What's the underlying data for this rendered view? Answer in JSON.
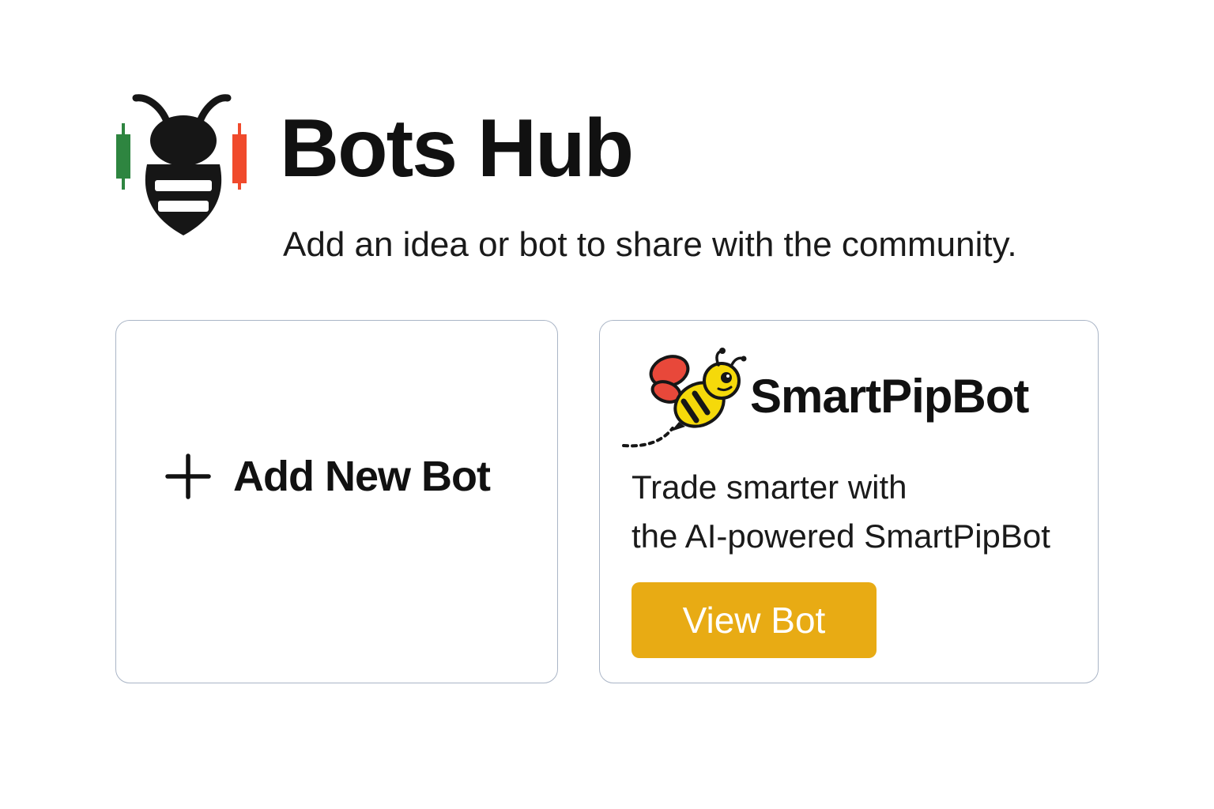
{
  "header": {
    "title": "Bots Hub",
    "subtitle": "Add an idea or bot to share with the community.",
    "logo_icon": "bee-candlestick-logo-icon"
  },
  "add_card": {
    "label": "Add New Bot",
    "icon": "plus-icon"
  },
  "bot_card": {
    "name": "SmartPipBot",
    "icon": "flying-bee-icon",
    "description_line1": "Trade smarter with",
    "description_line2": "the AI-powered SmartPipBot",
    "button_label": "View Bot"
  },
  "colors": {
    "accent": "#e8ab14",
    "card_border": "#aab5c6",
    "candle_up": "#2e8540",
    "candle_down": "#f04a2c",
    "bee_yellow": "#f5d90a",
    "bee_wing": "#e8483a",
    "text": "#111111"
  }
}
